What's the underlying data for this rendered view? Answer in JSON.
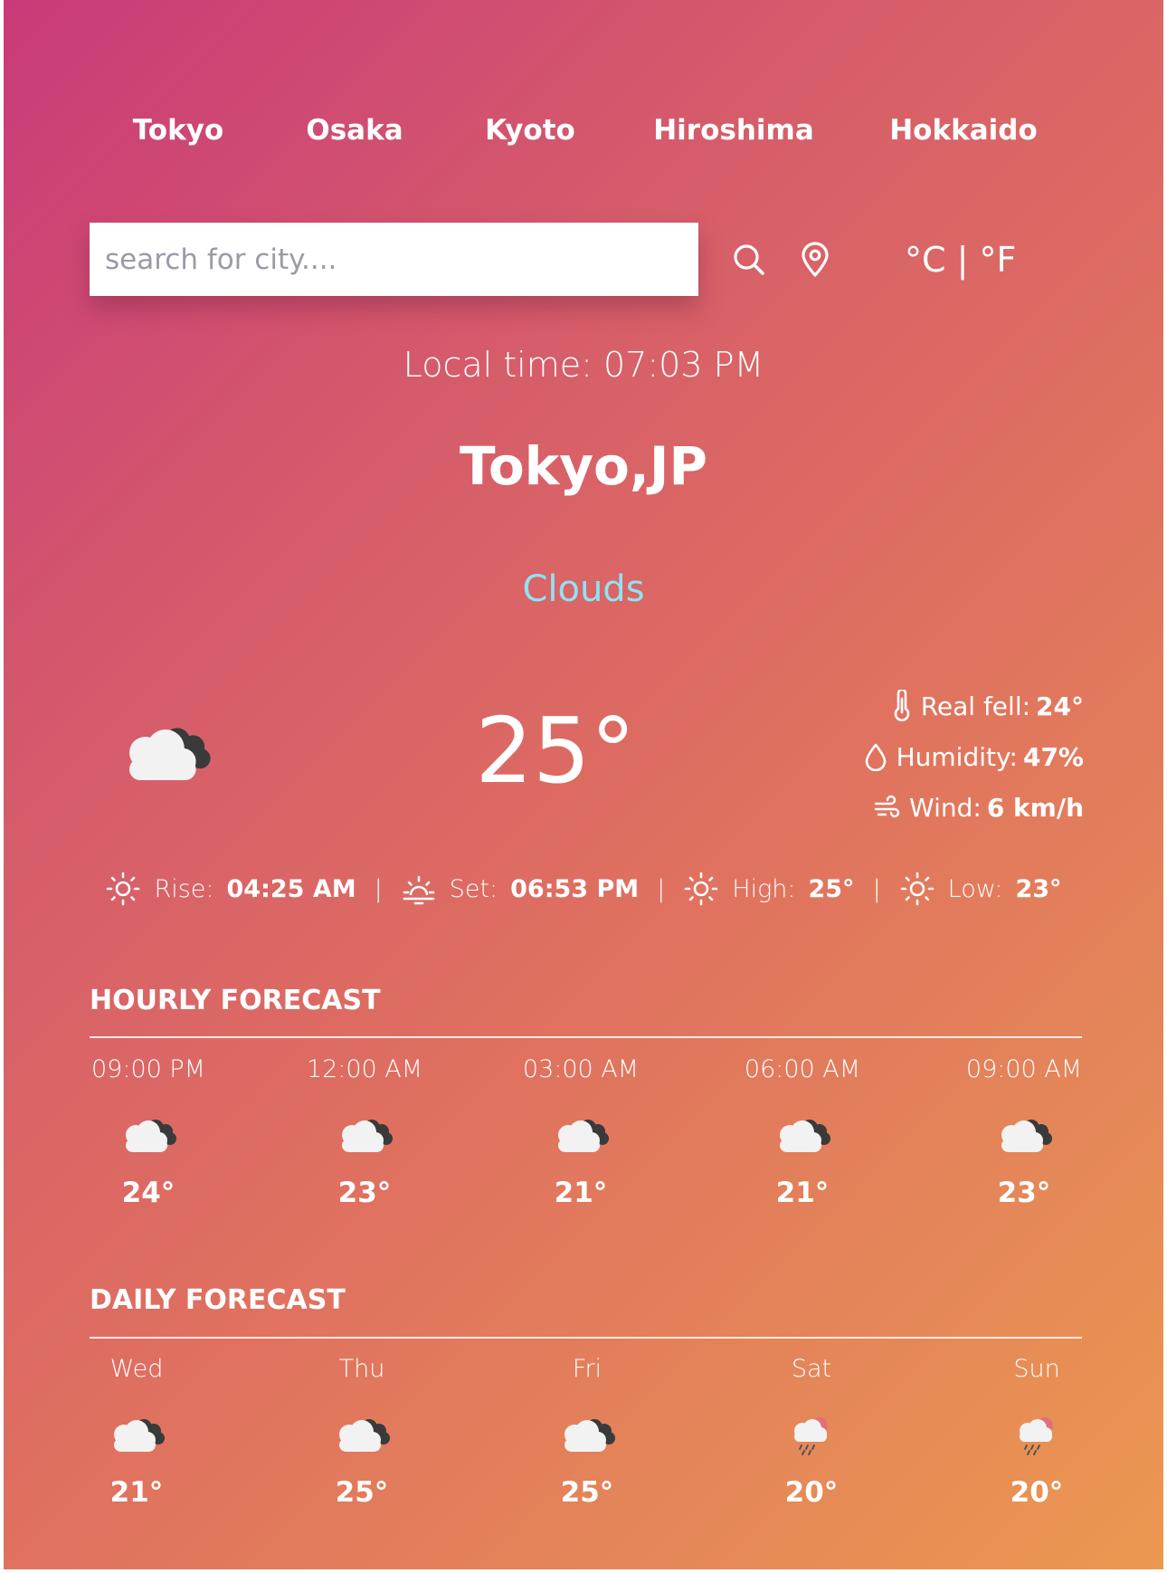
{
  "cities": [
    {
      "label": "Tokyo"
    },
    {
      "label": "Osaka"
    },
    {
      "label": "Kyoto"
    },
    {
      "label": "Hiroshima"
    },
    {
      "label": "Hokkaido"
    }
  ],
  "search": {
    "placeholder": "search for city...."
  },
  "units": {
    "celsius": "°C",
    "separator": "|",
    "fahrenheit": "°F"
  },
  "current": {
    "local_time": "Local time: 07:03 PM",
    "location": "Tokyo,JP",
    "condition": "Clouds",
    "condition_color": "#8ee3f5",
    "icon": "clouds-icon",
    "temperature": "25°",
    "details": [
      {
        "icon": "thermometer-icon",
        "label": "Real fell:",
        "value": "24°"
      },
      {
        "icon": "droplet-icon",
        "label": "Humidity:",
        "value": "47%"
      },
      {
        "icon": "wind-icon",
        "label": "Wind:",
        "value": "6 km/h"
      }
    ],
    "sun": [
      {
        "icon": "sun-icon",
        "label": "Rise:",
        "value": "04:25 AM"
      },
      {
        "icon": "sunset-icon",
        "label": "Set:",
        "value": "06:53 PM"
      },
      {
        "icon": "sun-icon",
        "label": "High:",
        "value": "25°"
      },
      {
        "icon": "sun-icon",
        "label": "Low:",
        "value": "23°"
      }
    ],
    "separator": "|"
  },
  "hourly": {
    "title": "HOURLY FORECAST",
    "items": [
      {
        "time": "09:00 PM",
        "icon": "clouds-icon",
        "temp": "24°"
      },
      {
        "time": "12:00 AM",
        "icon": "clouds-icon",
        "temp": "23°"
      },
      {
        "time": "03:00 AM",
        "icon": "clouds-icon",
        "temp": "21°"
      },
      {
        "time": "06:00 AM",
        "icon": "clouds-icon",
        "temp": "21°"
      },
      {
        "time": "09:00 AM",
        "icon": "clouds-icon",
        "temp": "23°"
      }
    ]
  },
  "daily": {
    "title": "DAILY FORECAST",
    "items": [
      {
        "day": "Wed",
        "icon": "clouds-icon",
        "temp": "21°"
      },
      {
        "day": "Thu",
        "icon": "clouds-icon",
        "temp": "25°"
      },
      {
        "day": "Fri",
        "icon": "clouds-icon",
        "temp": "25°"
      },
      {
        "day": "Sat",
        "icon": "rain-icon",
        "temp": "20°"
      },
      {
        "day": "Sun",
        "icon": "rain-icon",
        "temp": "20°"
      }
    ]
  },
  "colors": {
    "gradient_start": "#c93a79",
    "gradient_end": "#ec9850",
    "text": "#ffffff"
  }
}
